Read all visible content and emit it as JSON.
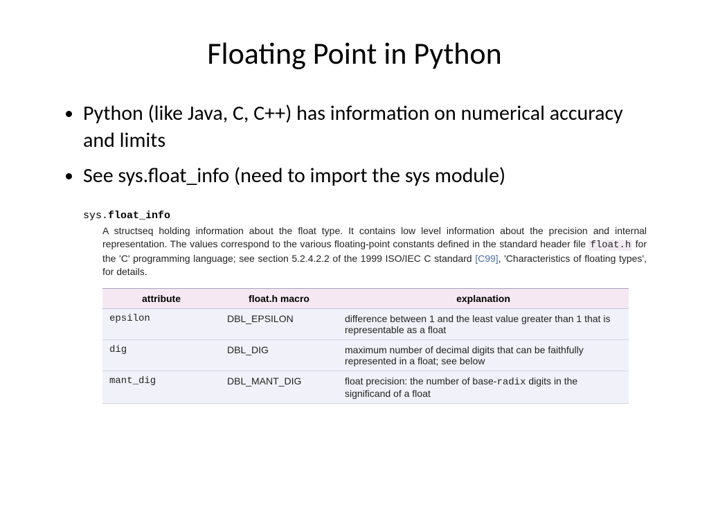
{
  "title": "Floating Point in Python",
  "bullets": [
    "Python (like Java, C, C++) has information on numerical accuracy and limits",
    "See sys.float_info (need to import the sys module)"
  ],
  "doc": {
    "module": "sys.",
    "name": "float_info",
    "desc_pre": "A structseq holding information about the float type. It contains low level information about the precision and internal representation. The values correspond to the various floating-point constants defined in the standard header file ",
    "desc_code": "float.h",
    "desc_mid": " for the 'C' programming language; see section 5.2.4.2.2 of the 1999 ISO/IEC C standard ",
    "desc_link": "[C99]",
    "desc_post": ", 'Characteristics of floating types', for details."
  },
  "table": {
    "headers": [
      "attribute",
      "float.h macro",
      "explanation"
    ],
    "rows": [
      {
        "attr": "epsilon",
        "macro": "DBL_EPSILON",
        "exp": "difference between 1 and the least value greater than 1 that is representable as a float"
      },
      {
        "attr": "dig",
        "macro": "DBL_DIG",
        "exp": "maximum number of decimal digits that can be faithfully represented in a float; see below"
      },
      {
        "attr": "mant_dig",
        "macro": "DBL_MANT_DIG",
        "exp_pre": "float precision: the number of base-",
        "exp_code": "radix",
        "exp_post": " digits in the significand of a float"
      }
    ]
  }
}
